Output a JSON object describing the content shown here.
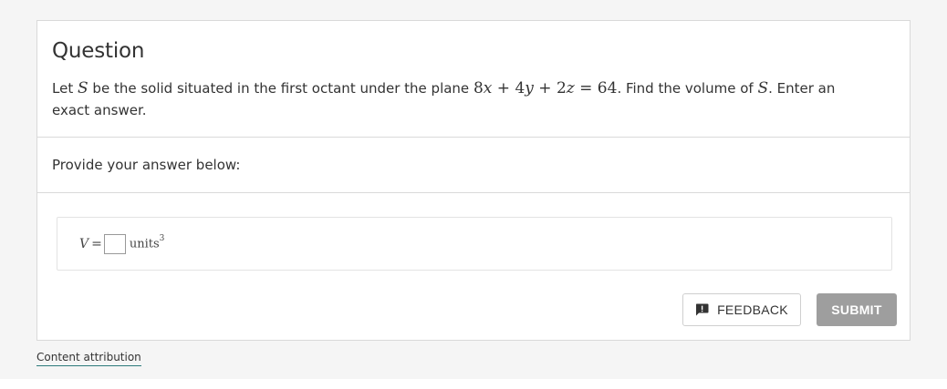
{
  "question": {
    "title": "Question",
    "text_intro": "Let",
    "var_s": "S",
    "text_mid": "be the solid situated in the first octant under the plane",
    "equation": {
      "c1": "8",
      "v1": "x",
      "op1": "+",
      "c2": "4",
      "v2": "y",
      "op2": "+",
      "c3": "2",
      "v3": "z",
      "eq": "=",
      "rhs": "64"
    },
    "text_after": ". Find the volume of",
    "var_s2": "S",
    "text_end": ". Enter an exact answer."
  },
  "prompt": {
    "label": "Provide your answer below:"
  },
  "answer": {
    "variable": "V",
    "equals": "=",
    "input_value": "",
    "units_label": "units",
    "units_exponent": "3"
  },
  "buttons": {
    "feedback_label": "FEEDBACK",
    "feedback_icon": "feedback-icon",
    "submit_label": "SUBMIT",
    "submit_color": "#9e9e9e"
  },
  "footer": {
    "attribution_link": "Content attribution",
    "link_underline_color": "#2c7a7b"
  }
}
